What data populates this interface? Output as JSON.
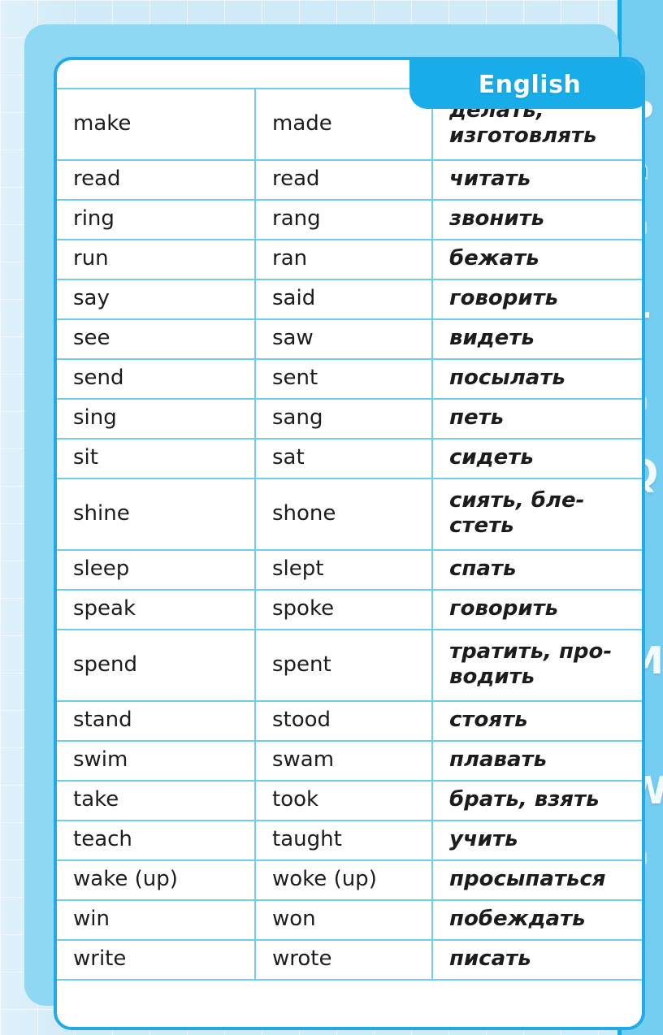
{
  "title_tab": {
    "label": "English"
  },
  "colors": {
    "accent": "#18ade9",
    "card_border": "#24a9e8",
    "table_line": "#6fcdee",
    "page_background": "#cfeaf8",
    "rail_background": "#74cef2",
    "text": "#1c1c1c"
  },
  "side_rail": {
    "letters": [
      "P",
      "L",
      "Q",
      "M",
      "W",
      "J"
    ],
    "icons": [
      "person-bookmark-icon",
      "square-dot-icon",
      "square-dot-icon",
      "square-dot-icon"
    ]
  },
  "table": {
    "columns": [
      "infinitive",
      "past_simple",
      "translation"
    ],
    "rows": [
      {
        "base": "make",
        "past": "made",
        "ru": [
          "делать,",
          "изготовлять"
        ],
        "tall": true
      },
      {
        "base": "read",
        "past": "read",
        "ru": [
          "читать"
        ],
        "tall": false
      },
      {
        "base": "ring",
        "past": "rang",
        "ru": [
          "звонить"
        ],
        "tall": false
      },
      {
        "base": "run",
        "past": "ran",
        "ru": [
          "бежать"
        ],
        "tall": false
      },
      {
        "base": "say",
        "past": "said",
        "ru": [
          "говорить"
        ],
        "tall": false
      },
      {
        "base": "see",
        "past": "saw",
        "ru": [
          "видеть"
        ],
        "tall": false
      },
      {
        "base": "send",
        "past": "sent",
        "ru": [
          "посылать"
        ],
        "tall": false
      },
      {
        "base": "sing",
        "past": "sang",
        "ru": [
          "петь"
        ],
        "tall": false
      },
      {
        "base": "sit",
        "past": "sat",
        "ru": [
          "сидеть"
        ],
        "tall": false
      },
      {
        "base": "shine",
        "past": "shone",
        "ru": [
          "сиять, бле-",
          "стеть"
        ],
        "tall": true
      },
      {
        "base": "sleep",
        "past": "slept",
        "ru": [
          "спать"
        ],
        "tall": false
      },
      {
        "base": "speak",
        "past": "spoke",
        "ru": [
          "говорить"
        ],
        "tall": false
      },
      {
        "base": "spend",
        "past": "spent",
        "ru": [
          "тратить, про-",
          "водить"
        ],
        "tall": true
      },
      {
        "base": "stand",
        "past": "stood",
        "ru": [
          "стоять"
        ],
        "tall": false
      },
      {
        "base": "swim",
        "past": "swam",
        "ru": [
          "плавать"
        ],
        "tall": false
      },
      {
        "base": "take",
        "past": "took",
        "ru": [
          "брать, взять"
        ],
        "tall": false
      },
      {
        "base": "teach",
        "past": "taught",
        "ru": [
          "учить"
        ],
        "tall": false
      },
      {
        "base": "wake (up)",
        "past": "woke (up)",
        "ru": [
          "просыпаться"
        ],
        "tall": false
      },
      {
        "base": "win",
        "past": "won",
        "ru": [
          "побеждать"
        ],
        "tall": false
      },
      {
        "base": "write",
        "past": "wrote",
        "ru": [
          "писать"
        ],
        "tall": false
      }
    ]
  }
}
